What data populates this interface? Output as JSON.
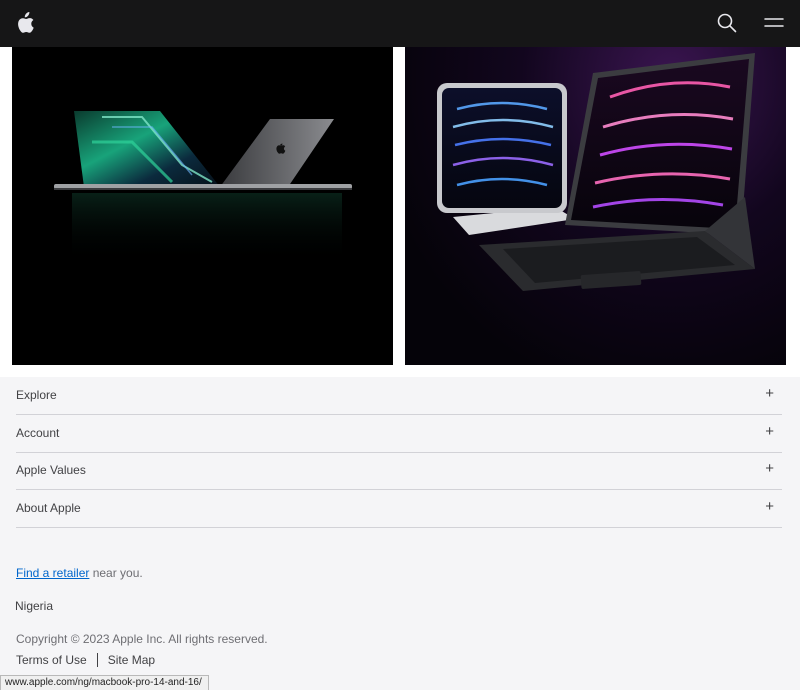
{
  "nav": {
    "logo_icon": "apple-logo-icon",
    "search_icon": "search-icon",
    "menu_icon": "menu-icon"
  },
  "tiles": [
    {
      "name": "macbook-pro-tile",
      "image": "MacBook Pro laptop on black background"
    },
    {
      "name": "ipad-pro-tile",
      "image": "iPad Pro with Magic Keyboard on dark purple background"
    }
  ],
  "footer": {
    "sections": [
      {
        "label": "Explore",
        "toggle": "+"
      },
      {
        "label": "Account",
        "toggle": "+"
      },
      {
        "label": "Apple Values",
        "toggle": "+"
      },
      {
        "label": "About Apple",
        "toggle": "+"
      }
    ],
    "retailer_link": "Find a retailer",
    "retailer_suffix": " near you.",
    "country": "Nigeria",
    "copyright": "Copyright © 2023 Apple Inc. All rights reserved.",
    "legal_links": [
      "Terms of Use",
      "Site Map"
    ]
  },
  "status_url": "www.apple.com/ng/macbook-pro-14-and-16/",
  "colors": {
    "nav_bg": "#161617",
    "footer_bg": "#f5f5f7",
    "link": "#0066cc"
  }
}
